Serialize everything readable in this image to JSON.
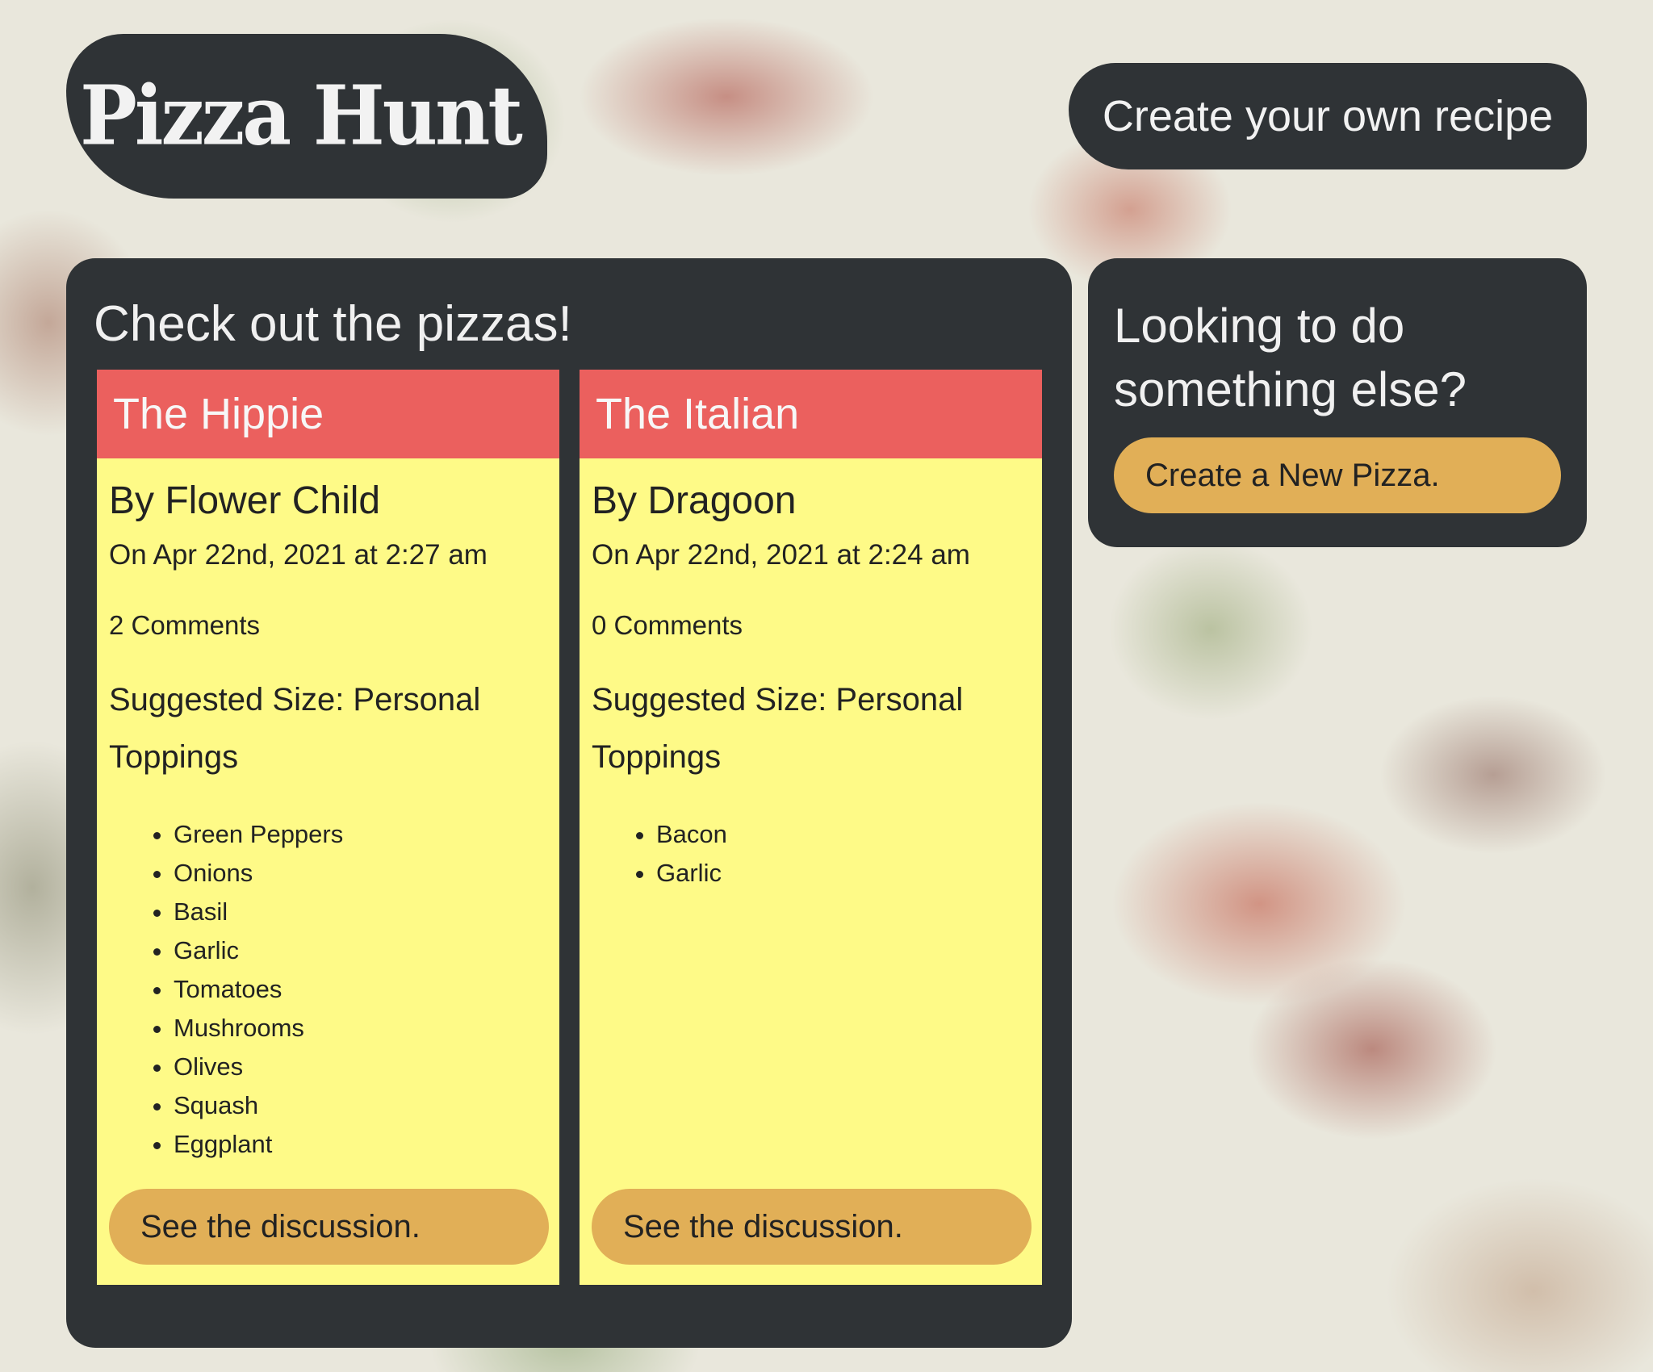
{
  "header": {
    "logo_text": "Pizza Hunt",
    "recipe_link": "Create your own recipe"
  },
  "main": {
    "heading": "Check out the pizzas!",
    "pizzas": [
      {
        "name": "The Hippie",
        "author": "By Flower Child",
        "date": "On Apr 22nd, 2021 at 2:27 am",
        "comments": "2 Comments",
        "size": "Suggested Size: Personal",
        "toppings_label": "Toppings",
        "toppings": [
          "Green Peppers",
          "Onions",
          "Basil",
          "Garlic",
          "Tomatoes",
          "Mushrooms",
          "Olives",
          "Squash",
          "Eggplant"
        ],
        "button": "See the discussion."
      },
      {
        "name": "The Italian",
        "author": "By Dragoon",
        "date": "On Apr 22nd, 2021 at 2:24 am",
        "comments": "0 Comments",
        "size": "Suggested Size: Personal",
        "toppings_label": "Toppings",
        "toppings": [
          "Bacon",
          "Garlic"
        ],
        "button": "See the discussion."
      }
    ]
  },
  "sidebar": {
    "heading": "Looking to do something else?",
    "button": "Create a New Pizza."
  },
  "colors": {
    "panel": "#2f3336",
    "card_header": "#eb605e",
    "card_body": "#fefa87",
    "button": "#e1af57"
  }
}
